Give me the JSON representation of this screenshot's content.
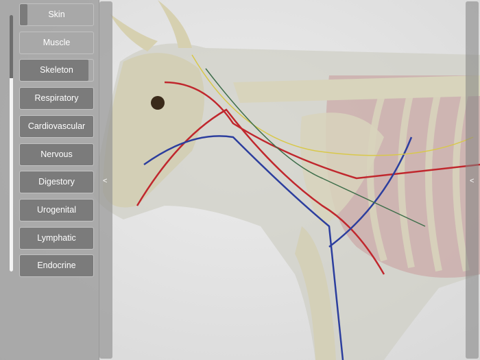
{
  "layers": [
    {
      "label": "Skin",
      "opacity": 0.1
    },
    {
      "label": "Muscle",
      "opacity": 0
    },
    {
      "label": "Skeleton",
      "opacity": 0.93
    },
    {
      "label": "Respiratory",
      "opacity": 1
    },
    {
      "label": "Cardiovascular",
      "opacity": 1
    },
    {
      "label": "Nervous",
      "opacity": 1
    },
    {
      "label": "Digestory",
      "opacity": 1
    },
    {
      "label": "Urogenital",
      "opacity": 1
    },
    {
      "label": "Lymphatic",
      "opacity": 1
    },
    {
      "label": "Endocrine",
      "opacity": 1
    }
  ],
  "panel_toggle_glyph": "<",
  "right_toggle_glyph": "<",
  "colors": {
    "panel": "#a0a0a0",
    "fill": "#7b7b7b",
    "artery": "#c0272d",
    "vein": "#2c3e9e",
    "nerve": "#d8c84a",
    "lymph": "#3e6e4a",
    "bone": "#d8d4bc"
  }
}
